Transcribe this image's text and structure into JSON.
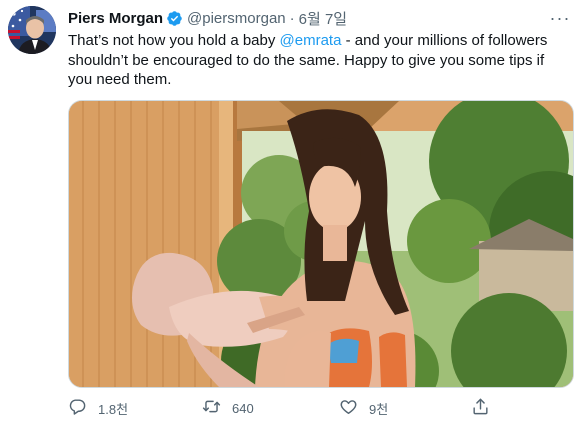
{
  "tweet": {
    "author_name": "Piers Morgan",
    "handle": "@piersmorgan",
    "separator": "·",
    "date": "6월 7일",
    "more_label": "···",
    "text_before_mention": "That’s not how you hold a baby ",
    "mention": "@emrata",
    "text_after_mention": " - and your millions of followers shouldn’t be encouraged to do the same. Happy to give you some tips if you need them."
  },
  "actions": {
    "reply_count": "1.8천",
    "retweet_count": "640",
    "like_count": "9천"
  },
  "icons": {
    "verified": "verified-badge-icon",
    "more": "more-icon",
    "reply": "reply-icon",
    "retweet": "retweet-icon",
    "like": "heart-icon",
    "share": "share-icon"
  },
  "colors": {
    "accent": "#1d9bf0",
    "muted": "#536471",
    "text": "#0f1419",
    "divider": "#cfd9de"
  }
}
